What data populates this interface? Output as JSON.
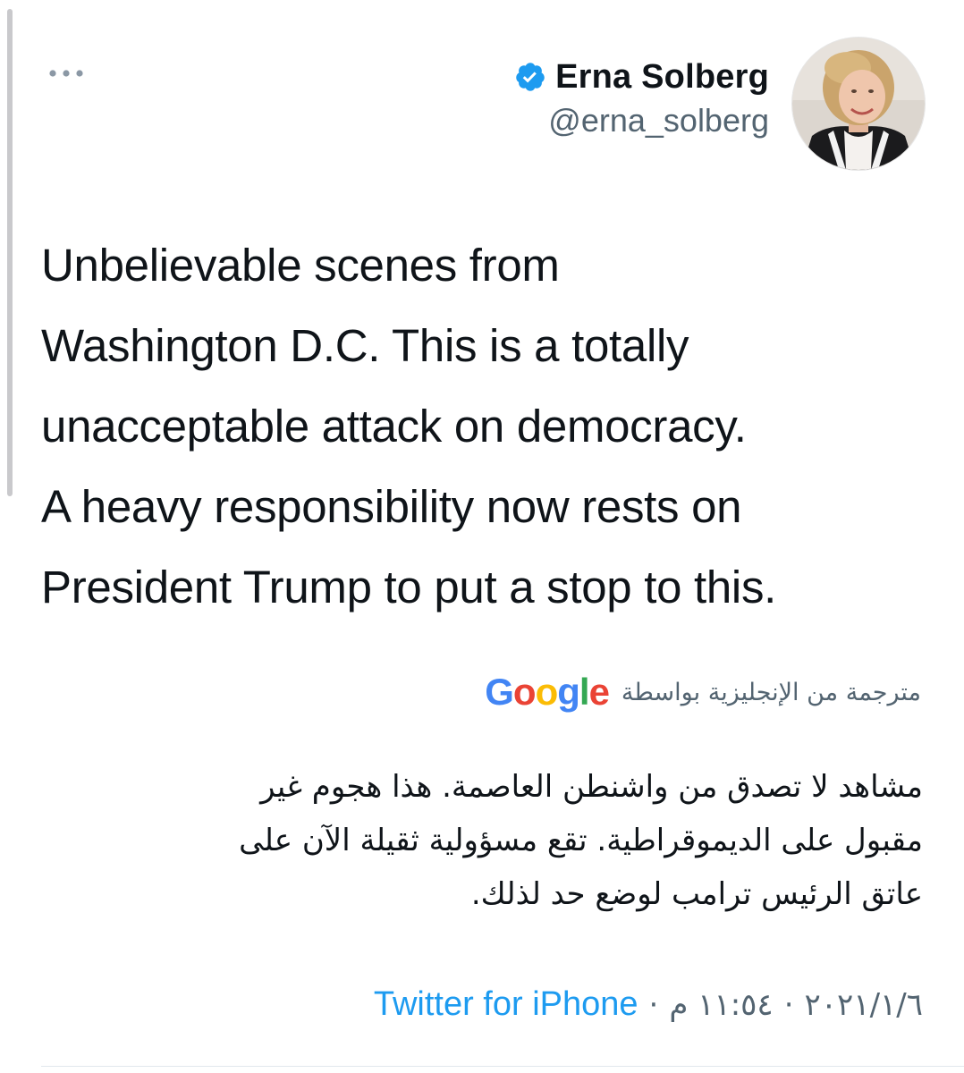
{
  "tweet": {
    "author_name": "Erna Solberg",
    "author_handle": "@erna_solberg",
    "verified": true,
    "text_lines": [
      "Unbelievable scenes from",
      "Washington D.C. This is a totally",
      "unacceptable attack on democracy.",
      "A heavy responsibility now rests on",
      "President Trump to put a stop to this."
    ],
    "translated_by_label": "مترجمة من الإنجليزية بواسطة",
    "google_logo": {
      "G": "G",
      "o1": "o",
      "o2": "o",
      "g": "g",
      "l": "l",
      "e": "e"
    },
    "translation_lines": [
      "مشاهد لا تصدق من واشنطن العاصمة. هذا هجوم غير",
      "مقبول على الديموقراطية. تقع مسؤولية ثقيلة الآن على",
      "عاتق الرئيس ترامب لوضع حد لذلك."
    ],
    "date": "٢٠٢١/١/٦",
    "separator": "·",
    "time": "١١:٥٤ م",
    "source": "Twitter for iPhone"
  },
  "colors": {
    "verified_blue": "#1d9bf0",
    "link_blue": "#1d9bf0",
    "secondary_text": "#536471",
    "primary_text": "#0f1419"
  },
  "icons": {
    "more": "more-horizontal-icon",
    "verified": "verified-badge-icon"
  }
}
